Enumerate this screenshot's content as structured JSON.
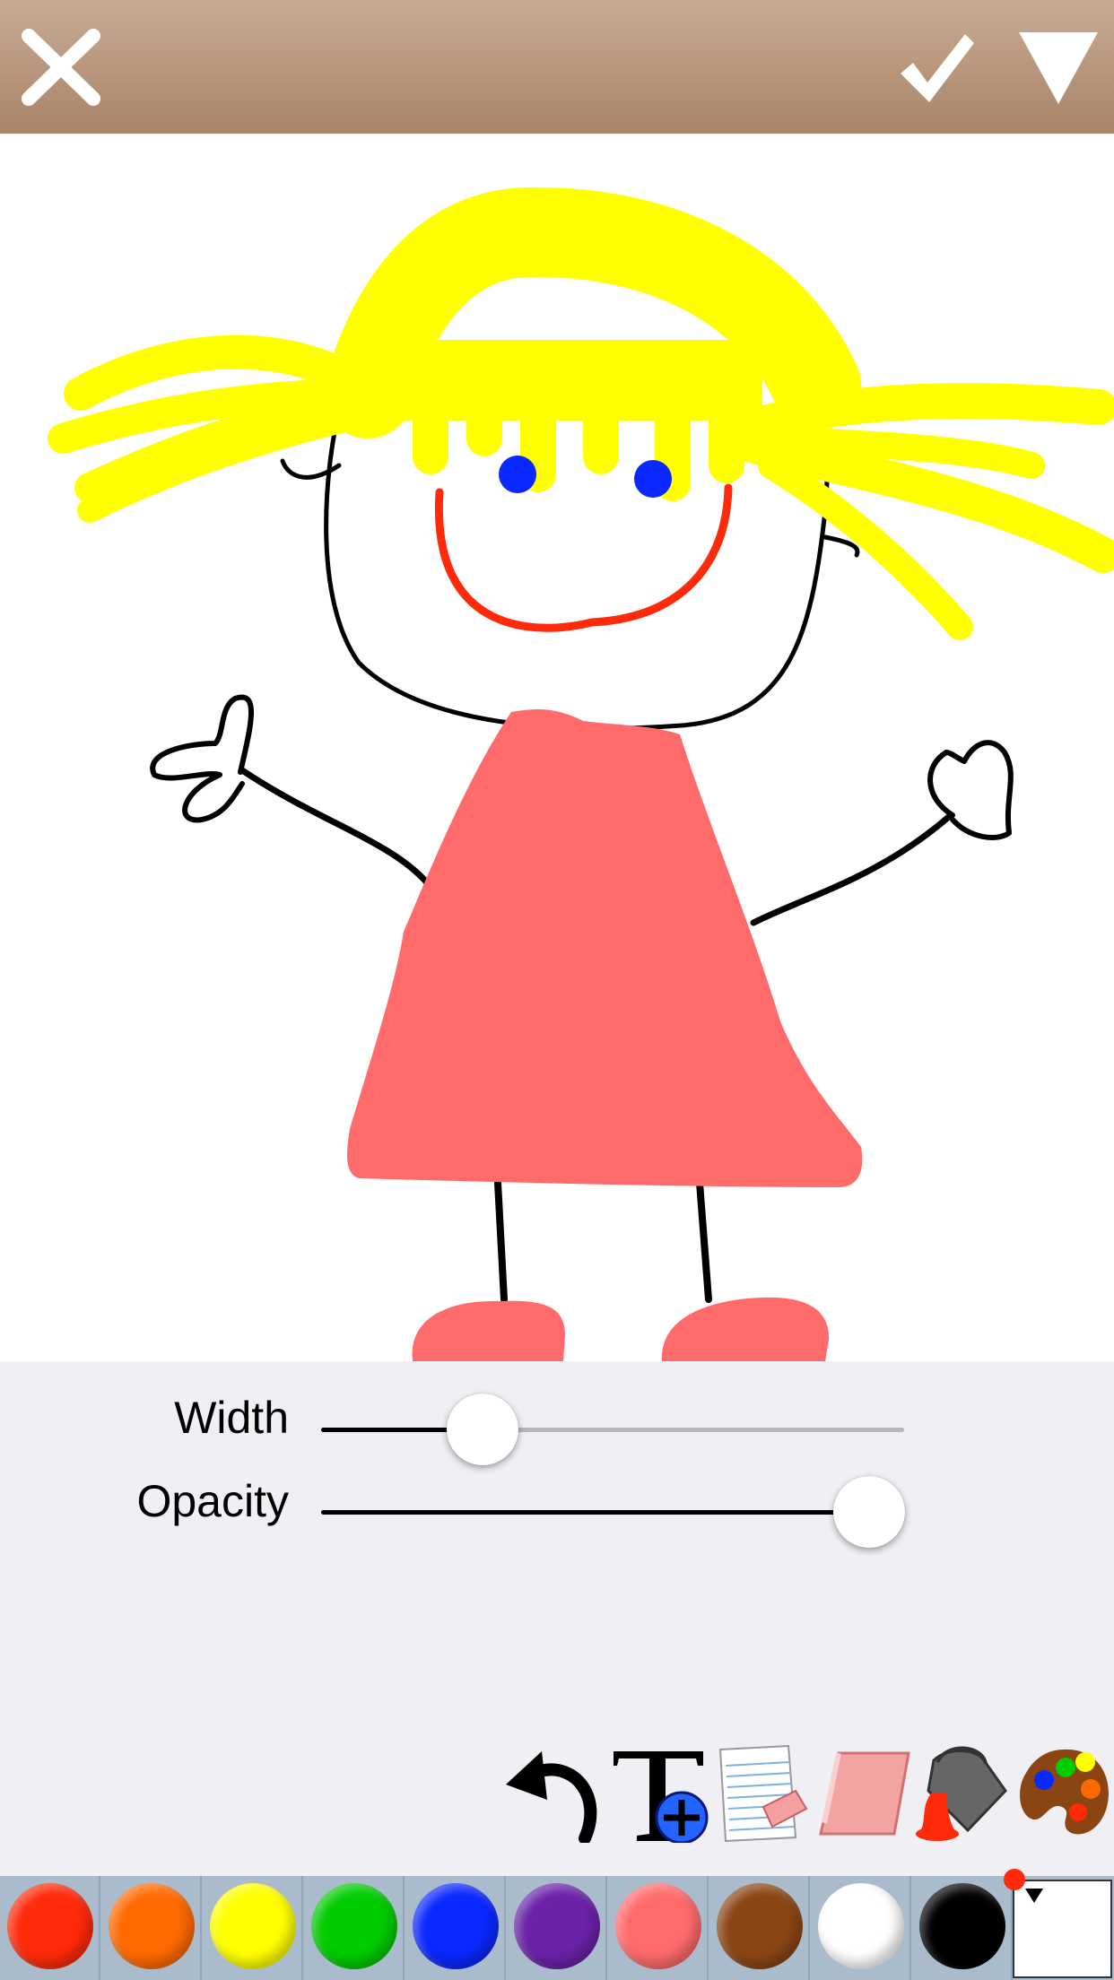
{
  "toolbar": {
    "close_icon": "close-x-icon",
    "confirm_icon": "checkmark-icon",
    "menu_icon": "dropdown-triangle-icon"
  },
  "sliders": {
    "width": {
      "label": "Width",
      "value": 0.277
    },
    "opacity": {
      "label": "Opacity",
      "value": 0.94
    }
  },
  "tools": [
    "undo-icon",
    "add-text-icon",
    "clear-page-icon",
    "eraser-icon",
    "paint-bucket-icon",
    "color-palette-icon"
  ],
  "palette": {
    "colors": [
      "#ff2a0a",
      "#ff6a00",
      "#ffff00",
      "#00cc00",
      "#0a28ff",
      "#6a22a8",
      "#ff6b6b",
      "#8b4513",
      "#ffffff",
      "#000000"
    ],
    "current_color": "#ff2a0a"
  },
  "drawing": {
    "hair": "#ffff00",
    "eyes": "#0a28ff",
    "smile": "#ff2a0a",
    "dress": "#ff6b6b",
    "outline": "#000000"
  }
}
